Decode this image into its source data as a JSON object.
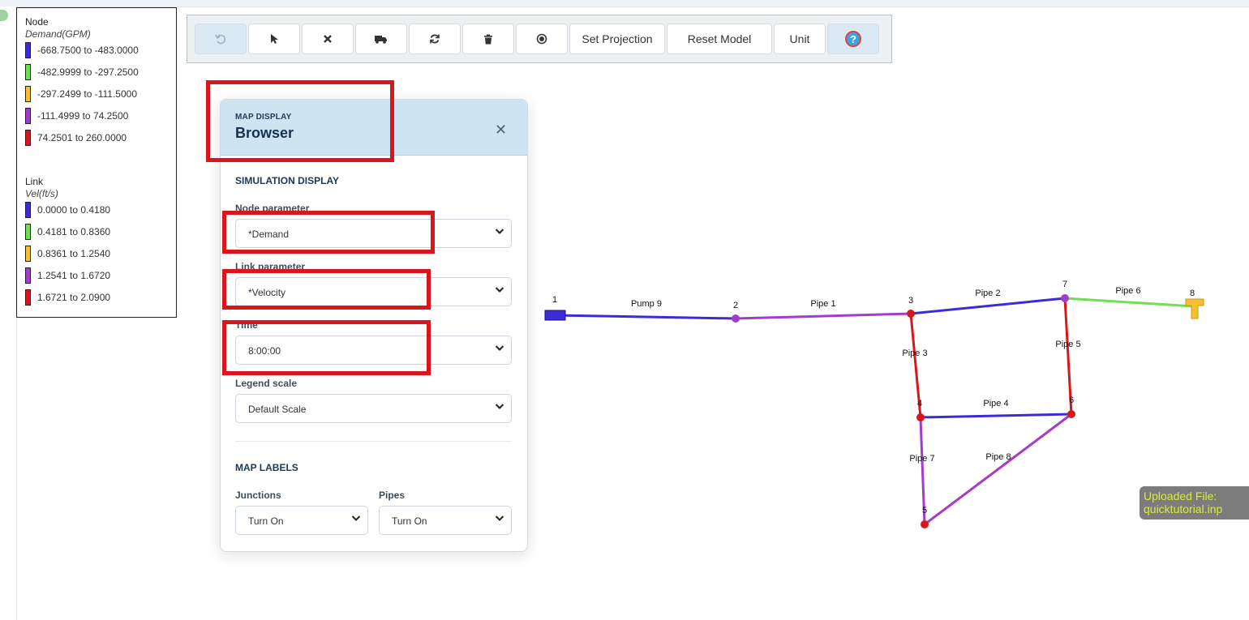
{
  "legend": {
    "node": {
      "title": "Node",
      "unit": "Demand(GPM)",
      "items": [
        {
          "label": "-668.7500 to -483.0000",
          "color": "#3b2bd9"
        },
        {
          "label": "-482.9999 to -297.2500",
          "color": "#6fe04f"
        },
        {
          "label": "-297.2499 to -111.5000",
          "color": "#f5c032"
        },
        {
          "label": "-111.4999 to 74.2500",
          "color": "#a23ccd"
        },
        {
          "label": "74.2501 to 260.0000",
          "color": "#d9161c"
        }
      ]
    },
    "link": {
      "title": "Link",
      "unit": "Vel(ft/s)",
      "items": [
        {
          "label": "0.0000 to 0.4180",
          "color": "#3b2bd9"
        },
        {
          "label": "0.4181 to 0.8360",
          "color": "#6fe04f"
        },
        {
          "label": "0.8361 to 1.2540",
          "color": "#f5c032"
        },
        {
          "label": "1.2541 to 1.6720",
          "color": "#a23ccd"
        },
        {
          "label": "1.6721 to 2.0900",
          "color": "#d9161c"
        }
      ]
    }
  },
  "toolbar": {
    "undo_icon": "undo-icon",
    "select_icon": "pointer-icon",
    "delete_icon": "x-icon",
    "truck_icon": "truck-icon",
    "refresh_icon": "refresh-icon",
    "trash_icon": "trash-icon",
    "record_icon": "record-icon",
    "set_projection": "Set Projection",
    "reset_model": "Reset Model",
    "unit": "Unit",
    "help_icon": "help-icon",
    "help_glyph": "?"
  },
  "panel": {
    "subtitle": "MAP DISPLAY",
    "title": "Browser",
    "close_glyph": "✕",
    "simulation_display": "SIMULATION DISPLAY",
    "node_parameter_label": "Node parameter",
    "node_parameter_value": "*Demand",
    "link_parameter_label": "Link parameter",
    "link_parameter_value": "*Velocity",
    "time_label": "Time",
    "time_value": "8:00:00",
    "legend_scale_label": "Legend scale",
    "legend_scale_value": "Default Scale",
    "map_labels": "MAP LABELS",
    "junctions_label": "Junctions",
    "junctions_value": "Turn On",
    "pipes_label": "Pipes",
    "pipes_value": "Turn On"
  },
  "network": {
    "nodes": [
      {
        "id": "1",
        "label": "1",
        "kind": "reservoir",
        "color": "#3b2bd9"
      },
      {
        "id": "2",
        "label": "2",
        "kind": "junction",
        "color": "#a23ccd"
      },
      {
        "id": "3",
        "label": "3",
        "kind": "junction",
        "color": "#d9161c"
      },
      {
        "id": "4",
        "label": "4",
        "kind": "junction",
        "color": "#d9161c"
      },
      {
        "id": "5",
        "label": "5",
        "kind": "junction",
        "color": "#d9161c"
      },
      {
        "id": "6",
        "label": "6",
        "kind": "junction",
        "color": "#d9161c"
      },
      {
        "id": "7",
        "label": "7",
        "kind": "junction",
        "color": "#a23ccd"
      },
      {
        "id": "8",
        "label": "8",
        "kind": "tank",
        "color": "#f5c032"
      }
    ],
    "links": [
      {
        "label": "Pump 9",
        "from": "1",
        "to": "2",
        "color": "#3b2bd9"
      },
      {
        "label": "Pipe 1",
        "from": "2",
        "to": "3",
        "color": "#a23ccd"
      },
      {
        "label": "Pipe 2",
        "from": "3",
        "to": "7",
        "color": "#3b2bd9"
      },
      {
        "label": "Pipe 6",
        "from": "7",
        "to": "8",
        "color": "#6fe04f"
      },
      {
        "label": "Pipe 3",
        "from": "3",
        "to": "4",
        "color": "#d9161c"
      },
      {
        "label": "Pipe 5",
        "from": "7",
        "to": "6",
        "color": "#d9161c"
      },
      {
        "label": "Pipe 4",
        "from": "4",
        "to": "6",
        "color": "#3b2bd9"
      },
      {
        "label": "Pipe 7",
        "from": "4",
        "to": "5",
        "color": "#a23ccd"
      },
      {
        "label": "Pipe 8",
        "from": "5",
        "to": "6",
        "color": "#a23ccd"
      }
    ]
  },
  "uploaded": {
    "line1": "Uploaded File:",
    "line2": "quicktutorial.inp"
  }
}
